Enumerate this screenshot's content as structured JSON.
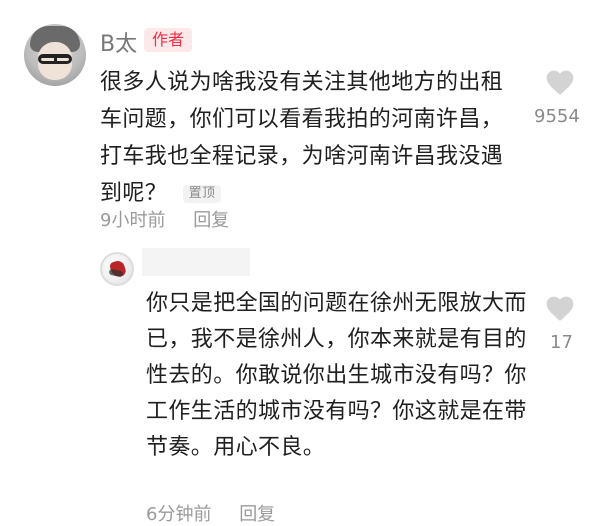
{
  "comment": {
    "author_name": "B太",
    "author_badge": "作者",
    "text": "很多人说为啥我没有关注其他地方的出租车问题，你们可以看看我拍的河南许昌，打车我也全程记录，为啥河南许昌我没遇到呢？",
    "pinned_label": "置顶",
    "like_icon": "heart-icon",
    "like_count": "9554",
    "time": "9小时前",
    "reply_label": "回复"
  },
  "reply": {
    "text": "你只是把全国的问题在徐州无限放大而已，我不是徐州人，你本来就是有目的性去的。你敢说你出生城市没有吗？你工作生活的城市没有吗？你这就是在带节奏。用心不良。",
    "like_icon": "heart-icon",
    "like_count": "17",
    "time": "6分钟前",
    "reply_label": "回复"
  },
  "colors": {
    "badge_bg": "#fde8ea",
    "badge_text": "#ef2f4a",
    "muted_text": "#8a8a8a",
    "heart_gray": "#d3d3d3"
  }
}
